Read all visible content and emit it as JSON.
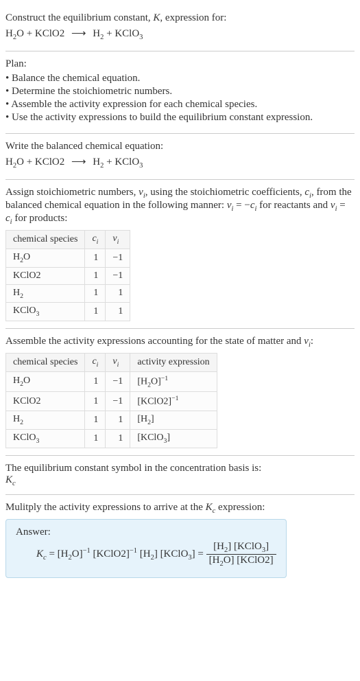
{
  "header": {
    "prompt1": "Construct the equilibrium constant, ",
    "K": "K",
    "prompt2": ", expression for:"
  },
  "main_reaction": {
    "r1": "H",
    "r1s": "2",
    "r1b": "O",
    "plus1": " + ",
    "r2": "KClO2",
    "arrow": "⟶",
    "p1": "H",
    "p1s": "2",
    "plus2": " + ",
    "p2": "KClO",
    "p2s": "3"
  },
  "plan": {
    "title": "Plan:",
    "items": [
      "Balance the chemical equation.",
      "Determine the stoichiometric numbers.",
      "Assemble the activity expression for each chemical species.",
      "Use the activity expressions to build the equilibrium constant expression."
    ]
  },
  "balanced": {
    "title": "Write the balanced chemical equation:"
  },
  "stoich": {
    "line1a": "Assign stoichiometric numbers, ",
    "nu": "ν",
    "i": "i",
    "line1b": ", using the stoichiometric coefficients, ",
    "c": "c",
    "line1c": ", from",
    "line2a": "the balanced chemical equation in the following manner: ",
    "eq1": "ν",
    "eq1i": "i",
    "eq1mid": " = −",
    "eq1c": "c",
    "eq1ci": "i",
    "line2b": " for reactants",
    "line3a": "and ",
    "eq2": "ν",
    "eq2i": "i",
    "eq2mid": " = ",
    "eq2c": "c",
    "eq2ci": "i",
    "line3b": " for products:"
  },
  "table1": {
    "h1": "chemical species",
    "h2": "c",
    "h2i": "i",
    "h3": "ν",
    "h3i": "i",
    "rows": [
      {
        "sp_a": "H",
        "sp_s": "2",
        "sp_b": "O",
        "c": "1",
        "nu": "−1"
      },
      {
        "sp_a": "KClO2",
        "sp_s": "",
        "sp_b": "",
        "c": "1",
        "nu": "−1"
      },
      {
        "sp_a": "H",
        "sp_s": "2",
        "sp_b": "",
        "c": "1",
        "nu": "1"
      },
      {
        "sp_a": "KClO",
        "sp_s": "3",
        "sp_b": "",
        "c": "1",
        "nu": "1"
      }
    ]
  },
  "activity": {
    "line1": "Assemble the activity expressions accounting for the state of matter and ",
    "nu": "ν",
    "i": "i",
    "colon": ":"
  },
  "table2": {
    "h1": "chemical species",
    "h2": "c",
    "h2i": "i",
    "h3": "ν",
    "h3i": "i",
    "h4": "activity expression",
    "rows": [
      {
        "sp_a": "H",
        "sp_s": "2",
        "sp_b": "O",
        "c": "1",
        "nu": "−1",
        "ae_a": "[H",
        "ae_s": "2",
        "ae_b": "O]",
        "ae_e": "−1"
      },
      {
        "sp_a": "KClO2",
        "sp_s": "",
        "sp_b": "",
        "c": "1",
        "nu": "−1",
        "ae_a": "[KClO2]",
        "ae_s": "",
        "ae_b": "",
        "ae_e": "−1"
      },
      {
        "sp_a": "H",
        "sp_s": "2",
        "sp_b": "",
        "c": "1",
        "nu": "1",
        "ae_a": "[H",
        "ae_s": "2",
        "ae_b": "]",
        "ae_e": ""
      },
      {
        "sp_a": "KClO",
        "sp_s": "3",
        "sp_b": "",
        "c": "1",
        "nu": "1",
        "ae_a": "[KClO",
        "ae_s": "3",
        "ae_b": "]",
        "ae_e": ""
      }
    ]
  },
  "kc_symbol": {
    "line": "The equilibrium constant symbol in the concentration basis is:",
    "K": "K",
    "c": "c"
  },
  "multiply": {
    "line1": "Mulitply the activity expressions to arrive at the ",
    "K": "K",
    "c": "c",
    "line2": " expression:"
  },
  "answer": {
    "label": "Answer:",
    "Kc_K": "K",
    "Kc_c": "c",
    "eq": " = ",
    "t1a": "[H",
    "t1s": "2",
    "t1b": "O]",
    "t1e": "−1",
    "sp1": " ",
    "t2a": "[KClO2]",
    "t2e": "−1",
    "sp2": " ",
    "t3a": "[H",
    "t3s": "2",
    "t3b": "]",
    "sp3": " ",
    "t4a": "[KClO",
    "t4s": "3",
    "t4b": "]",
    "eq2": " = ",
    "num1a": "[H",
    "num1s": "2",
    "num1b": "]",
    "numsp": " ",
    "num2a": "[KClO",
    "num2s": "3",
    "num2b": "]",
    "den1a": "[H",
    "den1s": "2",
    "den1b": "O]",
    "densp": " ",
    "den2": "[KClO2]"
  },
  "chart_data": null
}
